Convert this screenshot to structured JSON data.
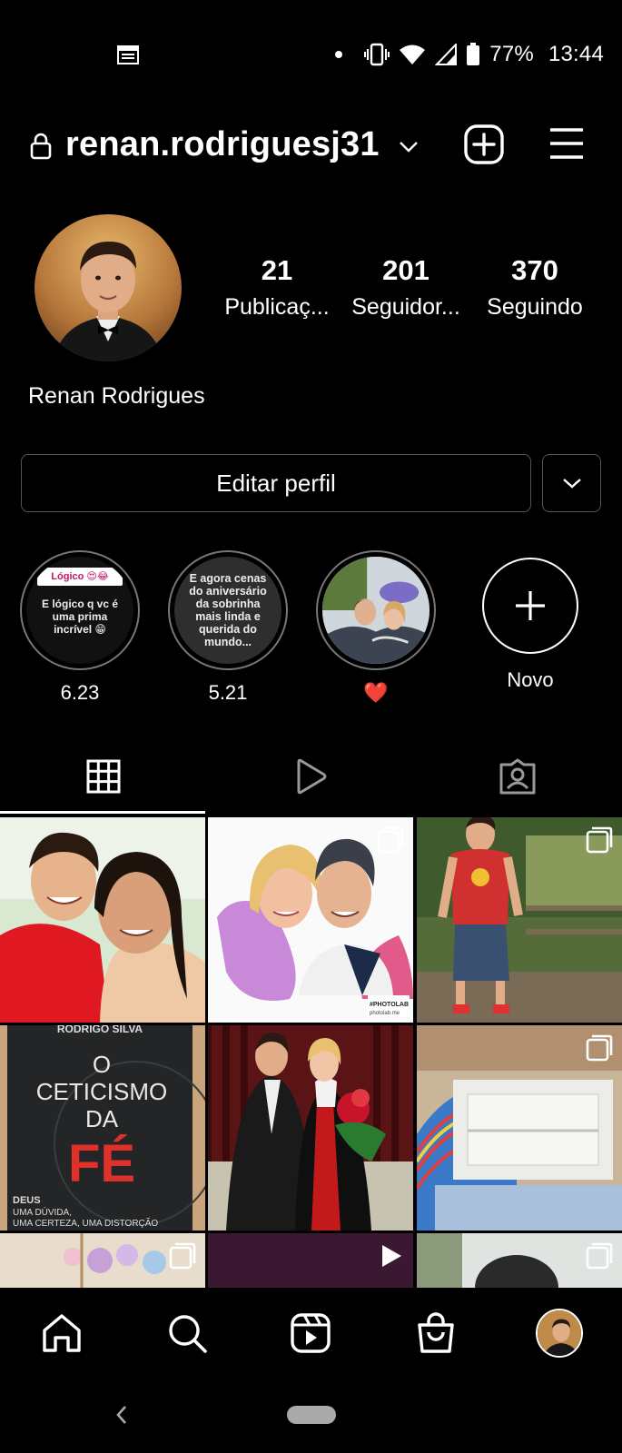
{
  "status_bar": {
    "battery": "77%",
    "time": "13:44",
    "icons": [
      "calendar-icon",
      "dot-icon",
      "vibrate-icon",
      "wifi-icon",
      "signal-icon",
      "battery-icon"
    ]
  },
  "header": {
    "username": "renan.rodriguesj31",
    "icons": [
      "lock-icon",
      "chevron-down-icon",
      "new-post-icon",
      "menu-icon"
    ]
  },
  "profile": {
    "full_name": "Renan Rodrigues",
    "stats": [
      {
        "value": "21",
        "label": "Publicaç..."
      },
      {
        "value": "201",
        "label": "Seguidor..."
      },
      {
        "value": "370",
        "label": "Seguindo"
      }
    ]
  },
  "actions": {
    "edit_profile": "Editar perfil"
  },
  "highlights": [
    {
      "label": "6.23",
      "cover_text": "E lógico q vc é uma prima incrível 😁",
      "cover_tag": "Lógico 😍😂"
    },
    {
      "label": "5.21",
      "cover_text": "E agora cenas do aniversário da sobrinha mais linda e querida do mundo..."
    },
    {
      "label": "❤️"
    },
    {
      "label": "Novo"
    }
  ],
  "tabs": [
    "grid-icon",
    "reels-icon",
    "tagged-icon"
  ],
  "grid": {
    "posts": [
      {
        "kind": "photo"
      },
      {
        "kind": "carousel",
        "watermark": "#PHOTOLAB",
        "watermark_sub": "photolab.me"
      },
      {
        "kind": "carousel"
      },
      {
        "kind": "photo",
        "book_author": "RODRIGO SILVA",
        "book_title_1": "O",
        "book_title_2": "CETICISMO",
        "book_title_3": "DA",
        "book_title_4": "FÉ",
        "book_sub_1": "DEUS",
        "book_sub_2": "UMA DÚVIDA,",
        "book_sub_3": "UMA CERTEZA, UMA DISTORÇÃO"
      },
      {
        "kind": "photo"
      },
      {
        "kind": "carousel"
      },
      {
        "kind": "carousel"
      },
      {
        "kind": "reel"
      },
      {
        "kind": "carousel"
      }
    ]
  },
  "bottom_nav": [
    "home-icon",
    "search-icon",
    "reels-icon",
    "shop-icon",
    "profile-avatar"
  ]
}
